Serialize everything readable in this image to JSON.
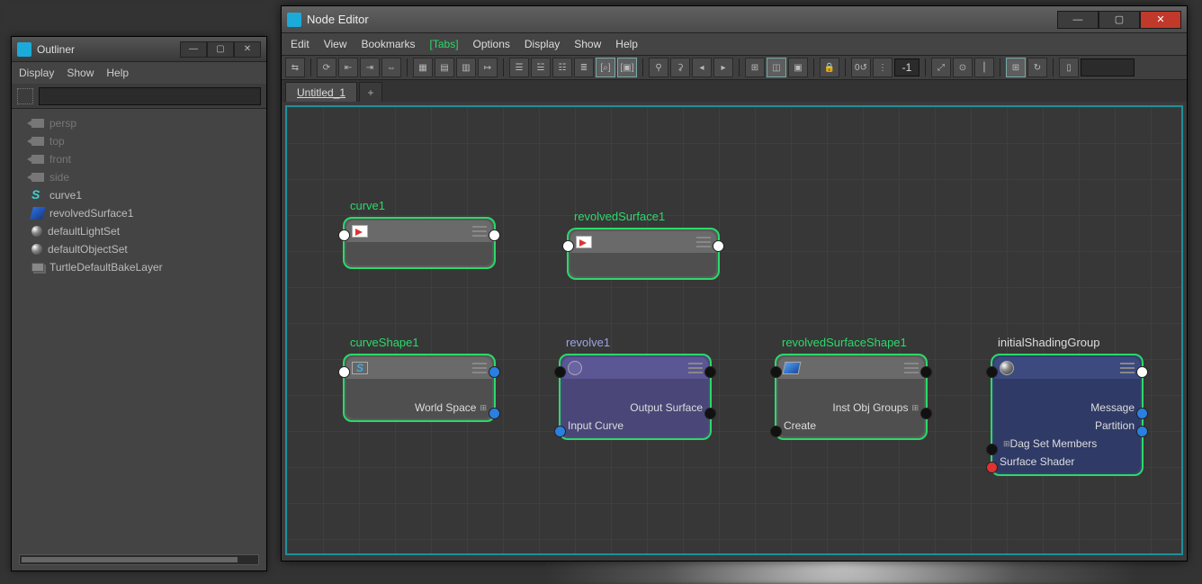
{
  "outliner": {
    "title": "Outliner",
    "menus": [
      "Display",
      "Show",
      "Help"
    ],
    "search_placeholder": "",
    "items": [
      {
        "label": "persp",
        "icon": "cam",
        "dim": true
      },
      {
        "label": "top",
        "icon": "cam",
        "dim": true
      },
      {
        "label": "front",
        "icon": "cam",
        "dim": true
      },
      {
        "label": "side",
        "icon": "cam",
        "dim": true
      },
      {
        "label": "curve1",
        "icon": "curve",
        "dim": false
      },
      {
        "label": "revolvedSurface1",
        "icon": "surf",
        "dim": false
      },
      {
        "label": "defaultLightSet",
        "icon": "ball",
        "dim": false
      },
      {
        "label": "defaultObjectSet",
        "icon": "ball",
        "dim": false
      },
      {
        "label": "TurtleDefaultBakeLayer",
        "icon": "layer",
        "dim": false
      }
    ]
  },
  "nodeed": {
    "title": "Node Editor",
    "menus": [
      "Edit",
      "View",
      "Bookmarks",
      "[Tabs]",
      "Options",
      "Display",
      "Show",
      "Help"
    ],
    "tab": "Untitled_1",
    "tool_value": "-1",
    "nodes": {
      "curve1": {
        "title": "curve1"
      },
      "revolvedSurface1": {
        "title": "revolvedSurface1"
      },
      "curveShape1": {
        "title": "curveShape1",
        "out": "World Space"
      },
      "revolve1": {
        "title": "revolve1",
        "out": "Output Surface",
        "in": "Input Curve"
      },
      "revolvedSurfaceShape1": {
        "title": "revolvedSurfaceShape1",
        "out": "Inst Obj Groups",
        "in": "Create"
      },
      "initialShadingGroup": {
        "title": "initialShadingGroup",
        "attrs": [
          "Message",
          "Partition",
          "Dag Set Members",
          "Surface Shader"
        ]
      }
    }
  }
}
